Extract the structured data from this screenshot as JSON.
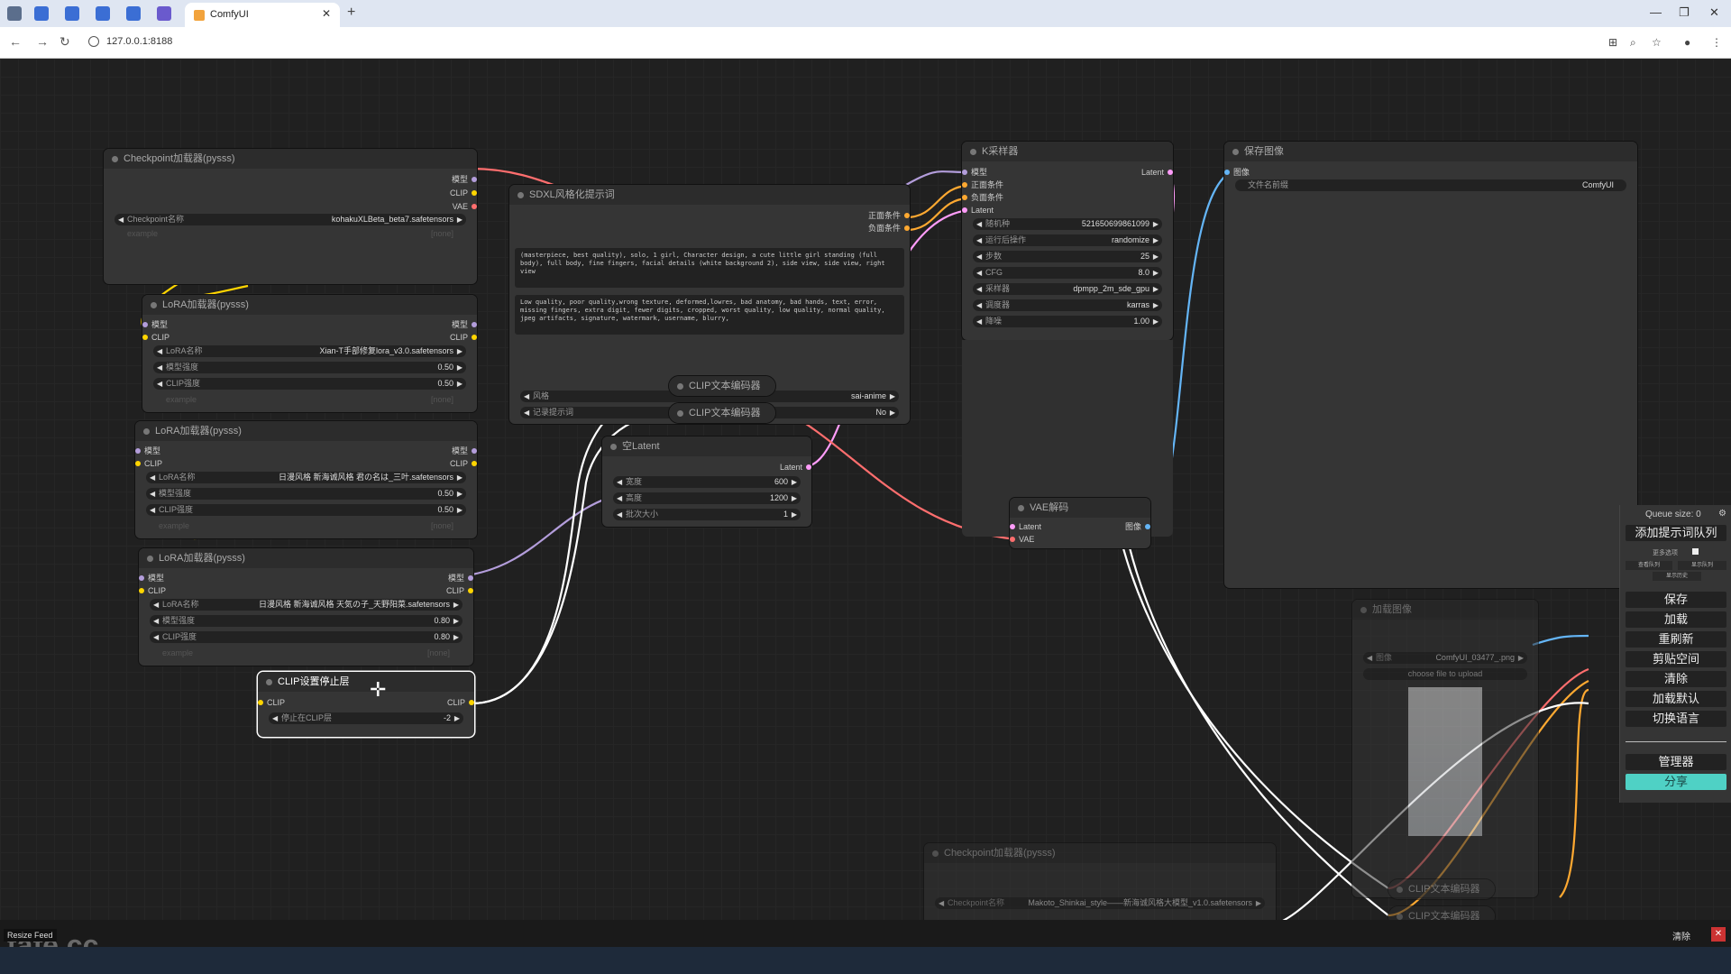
{
  "browser": {
    "tab_title": "ComfyUI",
    "url": "127.0.0.1:8188"
  },
  "nodes": {
    "checkpoint": {
      "title": "Checkpoint加载器(pysss)",
      "outputs": [
        "模型",
        "CLIP",
        "VAE"
      ],
      "ckpt_label": "Checkpoint名称",
      "ckpt_value": "kohakuXLBeta_beta7.safetensors",
      "example_label": "example",
      "example_value": "[none]"
    },
    "lora1": {
      "title": "LoRA加载器(pysss)",
      "in_model": "模型",
      "in_clip": "CLIP",
      "out_model": "模型",
      "out_clip": "CLIP",
      "name_label": "LoRA名称",
      "name_value": "Xian-T手部修复lora_v3.0.safetensors",
      "model_strength_label": "模型强度",
      "model_strength": "0.50",
      "clip_strength_label": "CLIP强度",
      "clip_strength": "0.50",
      "example_label": "example",
      "example_value": "[none]"
    },
    "lora2": {
      "title": "LoRA加载器(pysss)",
      "in_model": "模型",
      "in_clip": "CLIP",
      "out_model": "模型",
      "out_clip": "CLIP",
      "name_label": "LoRA名称",
      "name_value": "日漫风格 新海诚风格 君の名は_三叶.safetensors",
      "model_strength_label": "模型强度",
      "model_strength": "0.50",
      "clip_strength_label": "CLIP强度",
      "clip_strength": "0.50",
      "example_label": "example",
      "example_value": "[none]"
    },
    "lora3": {
      "title": "LoRA加载器(pysss)",
      "in_model": "模型",
      "in_clip": "CLIP",
      "out_model": "模型",
      "out_clip": "CLIP",
      "name_label": "LoRA名称",
      "name_value": "日漫风格 新海诚风格 天気の子_天野阳菜.safetensors",
      "model_strength_label": "模型强度",
      "model_strength": "0.80",
      "clip_strength_label": "CLIP强度",
      "clip_strength": "0.80",
      "example_label": "example",
      "example_value": "[none]"
    },
    "clip_stop": {
      "title": "CLIP设置停止层",
      "in_clip": "CLIP",
      "out_clip": "CLIP",
      "layer_label": "停止在CLIP层",
      "layer_value": "-2"
    },
    "sdxl_prompt": {
      "title": "SDXL风格化提示词",
      "out_pos": "正面条件",
      "out_neg": "负面条件",
      "positive": "(masterpiece, best quality), solo, 1 girl, Character design, a cute little girl standing (full body), full body, fine fingers, facial details (white background 2), side view, side view, right view",
      "negative": "Low quality, poor quality,wrong texture, deformed,lowres, bad anatomy, bad hands, text, error, missing fingers, extra digit, fewer digits, cropped, worst quality, low quality, normal quality, jpeg artifacts, signature, watermark, username, blurry,",
      "style_label": "风格",
      "style_value": "sai-anime",
      "log_label": "记录提示词",
      "log_value": "No"
    },
    "clip_enc1": {
      "title": "CLIP文本编码器"
    },
    "clip_enc2": {
      "title": "CLIP文本编码器"
    },
    "empty_latent": {
      "title": "空Latent",
      "out": "Latent",
      "width_label": "宽度",
      "width_value": "600",
      "height_label": "高度",
      "height_value": "1200",
      "batch_label": "批次大小",
      "batch_value": "1"
    },
    "ksampler": {
      "title": "K采样器",
      "inputs": [
        "模型",
        "正面条件",
        "负面条件",
        "Latent"
      ],
      "out": "Latent",
      "seed_label": "随机种",
      "seed_value": "521650699861099",
      "control_label": "运行后操作",
      "control_value": "randomize",
      "steps_label": "步数",
      "steps_value": "25",
      "cfg_label": "CFG",
      "cfg_value": "8.0",
      "sampler_label": "采样器",
      "sampler_value": "dpmpp_2m_sde_gpu",
      "scheduler_label": "调度器",
      "scheduler_value": "karras",
      "denoise_label": "降噪",
      "denoise_value": "1.00"
    },
    "save_image": {
      "title": "保存图像",
      "in_image": "图像",
      "prefix_label": "文件名前缀",
      "prefix_value": "ComfyUI"
    },
    "vae_decode": {
      "title": "VAE解码",
      "in_latent": "Latent",
      "in_vae": "VAE",
      "out_image": "图像"
    },
    "load_image": {
      "title": "加载图像",
      "image_label": "图像",
      "image_value": "ComfyUI_03477_.png",
      "upload_label": "choose file to upload"
    },
    "checkpoint2": {
      "title": "Checkpoint加载器(pysss)",
      "ckpt_label": "Checkpoint名称",
      "ckpt_value": "Makoto_Shinkai_style——新海诚风格大模型_v1.0.safetensors"
    },
    "clip_enc3": {
      "title": "CLIP文本编码器"
    },
    "clip_enc4": {
      "title": "CLIP文本编码器"
    }
  },
  "menu": {
    "queue_size": "Queue size: 0",
    "queue_prompt": "添加提示词队列",
    "extra_options": "更多选项",
    "view_queue": "查看队列",
    "view_history": "显示队列",
    "view_history2": "显示历史",
    "save": "保存",
    "load": "加载",
    "refresh": "重刷新",
    "clipspace": "剪贴空间",
    "clear": "清除",
    "load_default": "加载默认",
    "switch_lang": "切换语言",
    "manager": "管理器",
    "share": "分享"
  },
  "bottom": {
    "resize_feed": "Resize Feed",
    "clear": "清除",
    "watermark": "tafe.cc"
  },
  "link_colors": {
    "model": "#b39ddb",
    "clip": "#ffd500",
    "vae": "#ff6e6e",
    "conditioning": "#ffa931",
    "latent": "#ff9cf9",
    "image": "#64b5f6",
    "white": "#ffffff"
  }
}
